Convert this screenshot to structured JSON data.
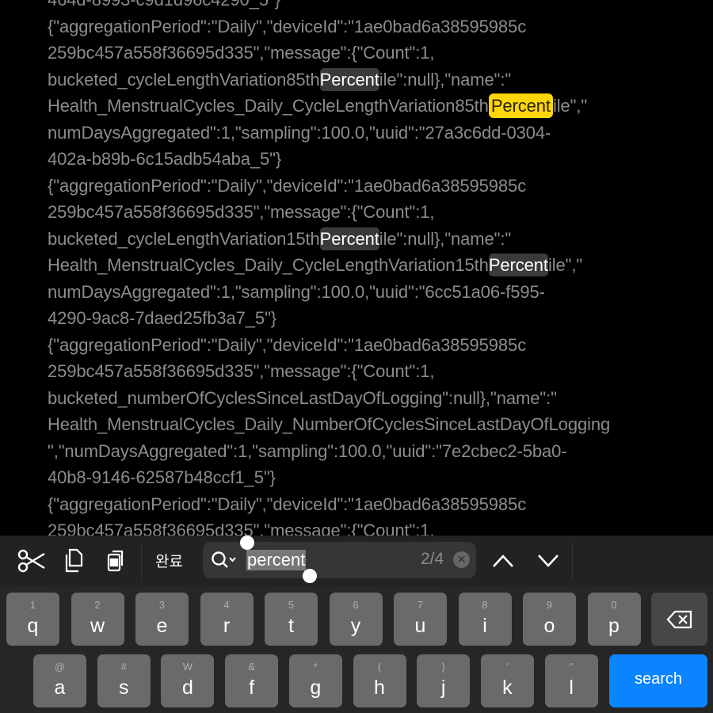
{
  "document": {
    "lines": [
      [
        {
          "t": "464d-8993-c9d1d96c4290_5\"}"
        }
      ],
      [
        {
          "t": "{\"aggregationPeriod\":\"Daily\",\"deviceId\":\"1ae0bad6a38595985c"
        }
      ],
      [
        {
          "t": "259bc457a558f36695d335\",\"message\":{\"Count\":1,"
        }
      ],
      [
        {
          "t": "bucketed_cycleLengthVariation85th"
        },
        {
          "t": "Percent",
          "m": "match"
        },
        {
          "t": "ile\":null},\"name\":\""
        }
      ],
      [
        {
          "t": "Health_MenstrualCycles_Daily_CycleLengthVariation85th"
        },
        {
          "t": "Percent",
          "m": "current"
        },
        {
          "t": "ile\",\""
        }
      ],
      [
        {
          "t": "numDaysAggregated\":1,\"sampling\":100.0,\"uuid\":\"27a3c6dd-0304-"
        }
      ],
      [
        {
          "t": "402a-b89b-6c15adb54aba_5\"}"
        }
      ],
      [
        {
          "t": "{\"aggregationPeriod\":\"Daily\",\"deviceId\":\"1ae0bad6a38595985c"
        }
      ],
      [
        {
          "t": "259bc457a558f36695d335\",\"message\":{\"Count\":1,"
        }
      ],
      [
        {
          "t": "bucketed_cycleLengthVariation15th"
        },
        {
          "t": "Percent",
          "m": "match"
        },
        {
          "t": "ile\":null},\"name\":\""
        }
      ],
      [
        {
          "t": "Health_MenstrualCycles_Daily_CycleLengthVariation15th"
        },
        {
          "t": "Percent",
          "m": "match"
        },
        {
          "t": "ile\",\""
        }
      ],
      [
        {
          "t": "numDaysAggregated\":1,\"sampling\":100.0,\"uuid\":\"6cc51a06-f595-"
        }
      ],
      [
        {
          "t": "4290-9ac8-7daed25fb3a7_5\"}"
        }
      ],
      [
        {
          "t": "{\"aggregationPeriod\":\"Daily\",\"deviceId\":\"1ae0bad6a38595985c"
        }
      ],
      [
        {
          "t": "259bc457a558f36695d335\",\"message\":{\"Count\":1,"
        }
      ],
      [
        {
          "t": "bucketed_numberOfCyclesSinceLastDayOfLogging\":null},\"name\":\""
        }
      ],
      [
        {
          "t": "Health_MenstrualCycles_Daily_NumberOfCyclesSinceLastDayOfLogging"
        }
      ],
      [
        {
          "t": "\",\"numDaysAggregated\":1,\"sampling\":100.0,\"uuid\":\"7e2cbec2-5ba0-"
        }
      ],
      [
        {
          "t": "40b8-9146-62587b48ccf1_5\"}"
        }
      ],
      [
        {
          "t": "{\"aggregationPeriod\":\"Daily\",\"deviceId\":\"1ae0bad6a38595985c"
        }
      ],
      [
        {
          "t": "259bc457a558f36695d335\",\"message\":{\"Count\":1,"
        }
      ]
    ]
  },
  "toolbar": {
    "icons": [
      "scissors-icon",
      "copy-icon",
      "paste-icon"
    ],
    "done_label": "완료",
    "search_value": "percent",
    "match_count": "2/4",
    "clear_icon": "✕",
    "prev_icon": "chevron-up-icon",
    "next_icon": "chevron-down-icon"
  },
  "keyboard": {
    "row1": [
      {
        "k": "q",
        "s": "1"
      },
      {
        "k": "w",
        "s": "2"
      },
      {
        "k": "e",
        "s": "3"
      },
      {
        "k": "r",
        "s": "4"
      },
      {
        "k": "t",
        "s": "5"
      },
      {
        "k": "y",
        "s": "6"
      },
      {
        "k": "u",
        "s": "7"
      },
      {
        "k": "i",
        "s": "8"
      },
      {
        "k": "o",
        "s": "9"
      },
      {
        "k": "p",
        "s": "0"
      }
    ],
    "row2": [
      {
        "k": "a",
        "s": "@"
      },
      {
        "k": "s",
        "s": "#"
      },
      {
        "k": "d",
        "s": "W"
      },
      {
        "k": "f",
        "s": "&"
      },
      {
        "k": "g",
        "s": "*"
      },
      {
        "k": "h",
        "s": "("
      },
      {
        "k": "j",
        "s": ")"
      },
      {
        "k": "k",
        "s": "'"
      },
      {
        "k": "l",
        "s": "\""
      }
    ],
    "search_label": "search"
  },
  "colors": {
    "current_match": "#ffd60a",
    "match": "#3a3a3a",
    "search_key": "#0a84ff"
  }
}
